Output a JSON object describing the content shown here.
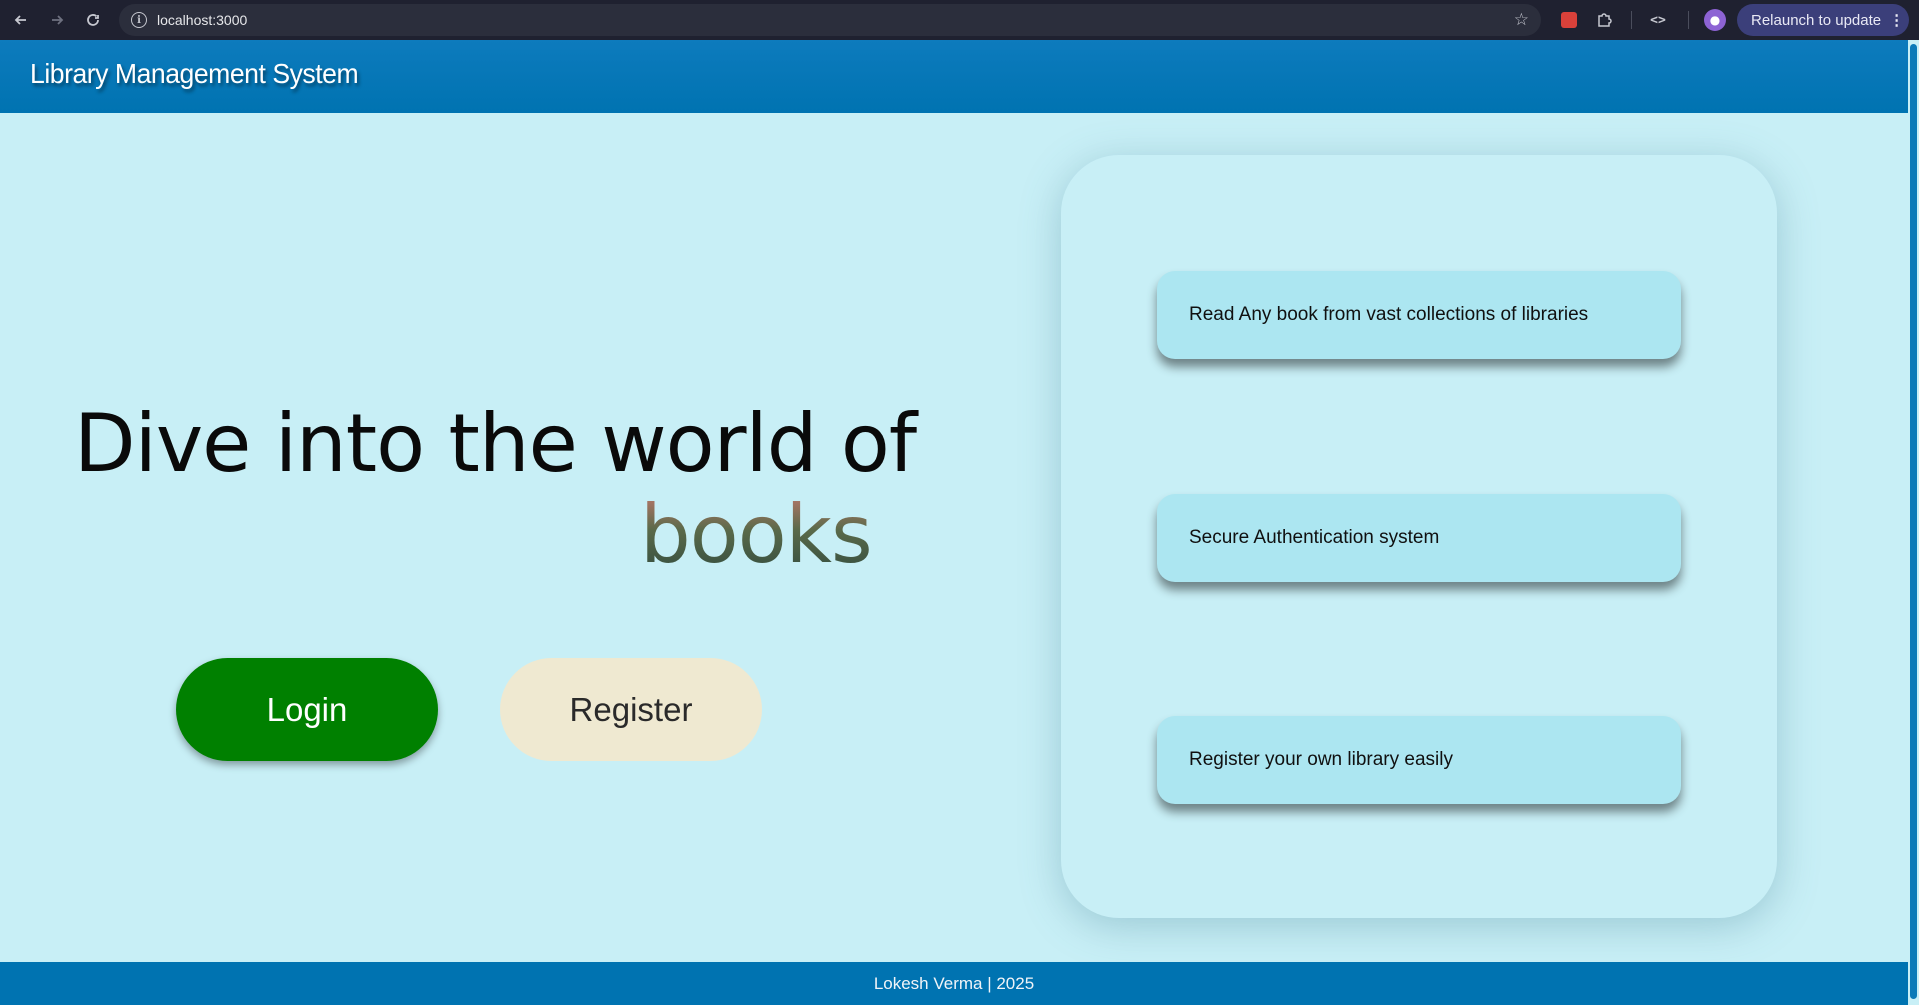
{
  "browser": {
    "url": "localhost:3000",
    "relaunch_label": "Relaunch to update",
    "relaunch_menu": "⋮"
  },
  "header": {
    "title": "Library Management System"
  },
  "hero": {
    "line1": "Dive into the world of",
    "line2": "books"
  },
  "actions": {
    "login_label": "Login",
    "register_label": "Register"
  },
  "features": [
    "Read Any book from vast collections of libraries",
    "Secure Authentication system",
    "Register your own library easily"
  ],
  "footer": {
    "text": "Lokesh Verma | 2025"
  },
  "colors": {
    "page_background": "#c8eff6",
    "header_background": "#0073b1",
    "login_button": "#008000",
    "register_button": "#efe9d1",
    "feature_item": "#ace6f1"
  }
}
